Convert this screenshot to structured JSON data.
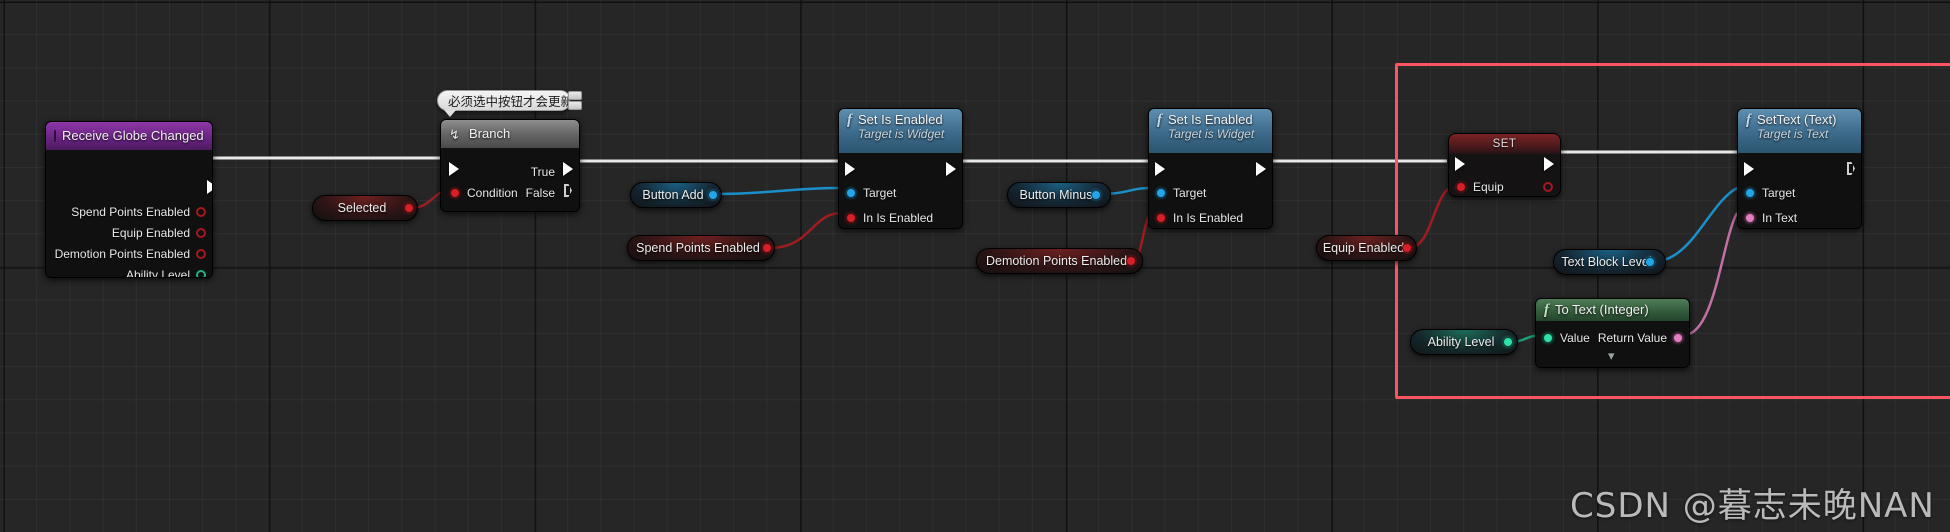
{
  "graph": {
    "background_color": "#262626",
    "highlight_color": "#fb5561",
    "watermark": "CSDN @暮志未晚NAN"
  },
  "comment_bubble": {
    "text": "必须选中按钮才会更新"
  },
  "nodes": {
    "receive_globe_changed": {
      "title": "Receive Globe Changed",
      "icon": "event-icon",
      "pins": [
        {
          "label": "Spend Points Enabled",
          "type": "bool-hollow"
        },
        {
          "label": "Equip Enabled",
          "type": "bool-hollow"
        },
        {
          "label": "Demotion Points Enabled",
          "type": "bool-hollow"
        },
        {
          "label": "Ability Level",
          "type": "int-hollow"
        }
      ]
    },
    "selected": {
      "label": "Selected",
      "type": "bool"
    },
    "branch": {
      "title": "Branch",
      "icon": "branch-icon",
      "condition_label": "Condition",
      "true_label": "True",
      "false_label": "False"
    },
    "set_is_enabled_1": {
      "title": "Set Is Enabled",
      "subtitle": "Target is Widget",
      "icon": "function-icon",
      "pins": [
        {
          "label": "Target",
          "type": "object"
        },
        {
          "label": "In Is Enabled",
          "type": "bool"
        }
      ]
    },
    "button_add": {
      "label": "Button Add",
      "type": "object"
    },
    "spend_points_enabled": {
      "label": "Spend Points Enabled",
      "type": "bool"
    },
    "set_is_enabled_2": {
      "title": "Set Is Enabled",
      "subtitle": "Target is Widget",
      "icon": "function-icon",
      "pins": [
        {
          "label": "Target",
          "type": "object"
        },
        {
          "label": "In Is Enabled",
          "type": "bool"
        }
      ]
    },
    "button_minus": {
      "label": "Button Minus",
      "type": "object"
    },
    "demotion_points_enabled": {
      "label": "Demotion Points Enabled",
      "type": "bool"
    },
    "set_node": {
      "title": "SET",
      "input_label": "Equip"
    },
    "equip_enabled": {
      "label": "Equip Enabled",
      "type": "bool"
    },
    "ability_level": {
      "label": "Ability Level",
      "type": "int"
    },
    "to_text_integer": {
      "title": "To Text (Integer)",
      "icon": "function-icon",
      "input_label": "Value",
      "output_label": "Return Value",
      "expander": "chevron-down-icon"
    },
    "text_block_level": {
      "label": "Text Block Level",
      "type": "object"
    },
    "set_text": {
      "title": "SetText (Text)",
      "subtitle": "Target is Text",
      "icon": "function-icon",
      "pins": [
        {
          "label": "Target",
          "type": "object"
        },
        {
          "label": "In Text",
          "type": "text"
        }
      ]
    }
  }
}
